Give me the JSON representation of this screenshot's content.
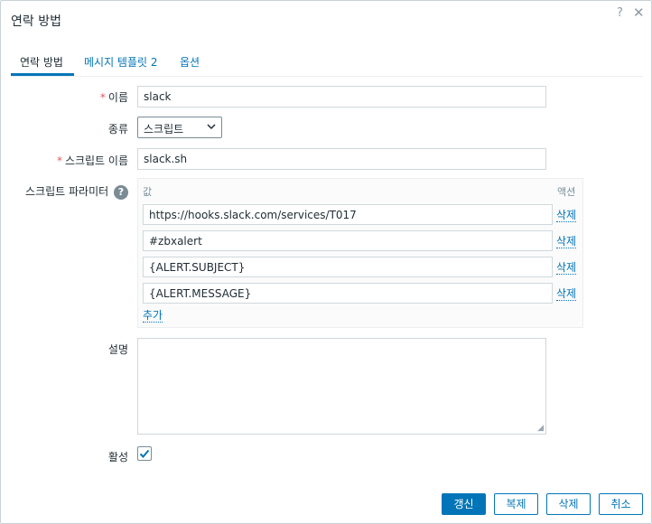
{
  "dialog": {
    "title": "연락 방법",
    "help_icon": "question-mark-icon",
    "close_icon": "close-icon"
  },
  "tabs": [
    {
      "label": "연락 방법"
    },
    {
      "label": "메시지 템플릿"
    },
    {
      "label": "옵션"
    }
  ],
  "tabs_count": "2",
  "form": {
    "required_mark": "*",
    "name_label": "이름",
    "name_value": "slack",
    "type_label": "종류",
    "type_value": "스크립트",
    "script_name_label": "스크립트 이름",
    "script_name_value": "slack.sh",
    "params_label": "스크립트 파라미터",
    "params_help": "?",
    "params_col_value": "값",
    "params_col_action": "액션",
    "params": [
      {
        "value": "https://hooks.slack.com/services/T017",
        "action": "삭제"
      },
      {
        "value": "#zbxalert",
        "action": "삭제"
      },
      {
        "value": "{ALERT.SUBJECT}",
        "action": "삭제"
      },
      {
        "value": "{ALERT.MESSAGE}",
        "action": "삭제"
      }
    ],
    "params_add": "추가",
    "description_label": "설명",
    "description_value": "",
    "enabled_label": "활성",
    "enabled": true
  },
  "buttons": {
    "update": "갱신",
    "clone": "복제",
    "delete": "삭제",
    "cancel": "취소"
  },
  "colors": {
    "accent": "#0275b8",
    "required": "#e45959"
  }
}
